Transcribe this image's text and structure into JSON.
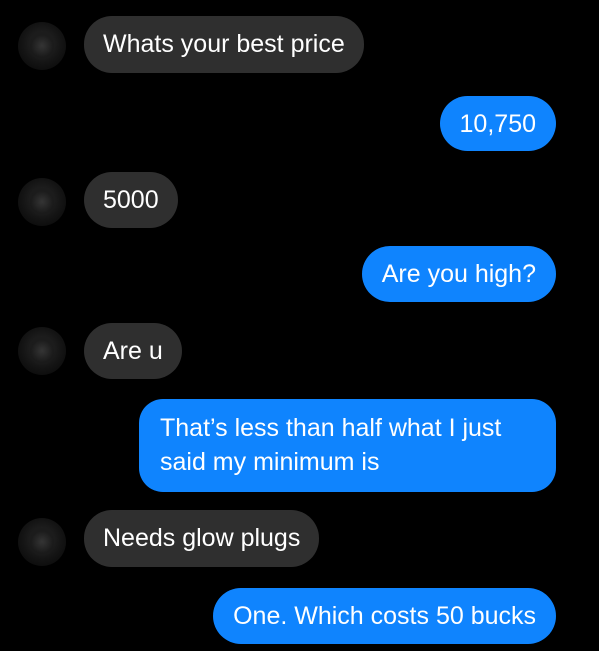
{
  "conversation": {
    "messages": [
      {
        "sender": "other",
        "text": "Whats your best price"
      },
      {
        "sender": "me",
        "text": "10,750"
      },
      {
        "sender": "other",
        "text": "5000"
      },
      {
        "sender": "me",
        "text": "Are you high?"
      },
      {
        "sender": "other",
        "text": "Are u"
      },
      {
        "sender": "me",
        "text": "That’s less than half what I just said my minimum is"
      },
      {
        "sender": "other",
        "text": "Needs glow plugs"
      },
      {
        "sender": "me",
        "text": "One. Which costs 50 bucks"
      }
    ]
  },
  "colors": {
    "background": "#000000",
    "incoming_bubble": "#2f2f2f",
    "outgoing_bubble": "#0f84fe",
    "text": "#ffffff"
  },
  "icons": {
    "avatar": "avatar"
  }
}
